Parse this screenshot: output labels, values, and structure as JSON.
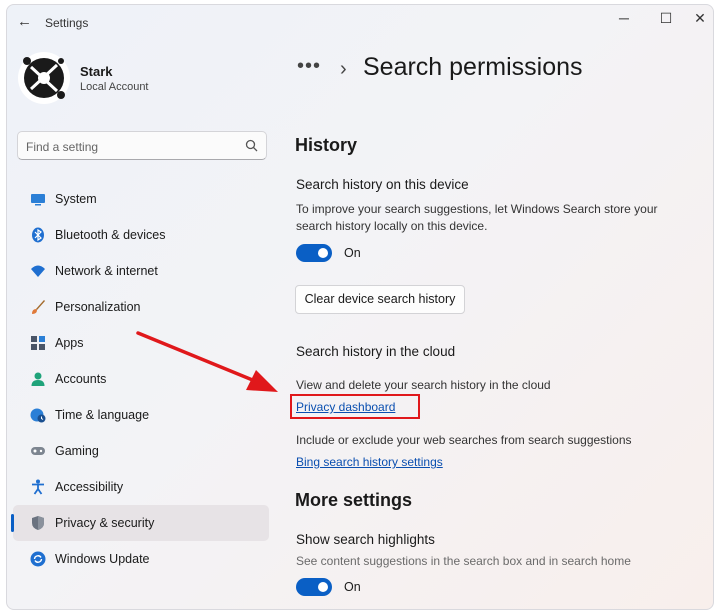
{
  "window": {
    "title": "Settings",
    "back_glyph": "←",
    "minimize_glyph": "─",
    "maximize_glyph": "☐",
    "close_glyph": "✕"
  },
  "user": {
    "name": "Stark",
    "account_type": "Local Account"
  },
  "search": {
    "placeholder": "Find a setting"
  },
  "nav": {
    "items": [
      {
        "label": "System",
        "icon": "system-icon"
      },
      {
        "label": "Bluetooth & devices",
        "icon": "bluetooth-icon"
      },
      {
        "label": "Network & internet",
        "icon": "wifi-icon"
      },
      {
        "label": "Personalization",
        "icon": "brush-icon"
      },
      {
        "label": "Apps",
        "icon": "apps-icon"
      },
      {
        "label": "Accounts",
        "icon": "accounts-icon"
      },
      {
        "label": "Time & language",
        "icon": "globe-clock-icon"
      },
      {
        "label": "Gaming",
        "icon": "gamepad-icon"
      },
      {
        "label": "Accessibility",
        "icon": "accessibility-icon"
      },
      {
        "label": "Privacy & security",
        "icon": "shield-icon",
        "active": true
      },
      {
        "label": "Windows Update",
        "icon": "update-icon"
      }
    ]
  },
  "breadcrumb": {
    "more": "•••",
    "separator": "›",
    "title": "Search permissions"
  },
  "history": {
    "heading": "History",
    "device_title": "Search history on this device",
    "device_desc_line1": "To improve your search suggestions, let Windows Search store your",
    "device_desc_line2": "search history locally on this device.",
    "device_toggle_state": "On",
    "clear_button": "Clear device search history",
    "cloud_title": "Search history in the cloud",
    "cloud_desc": "View and delete your search history in the cloud",
    "privacy_link": "Privacy dashboard",
    "web_desc": "Include or exclude your web searches from search suggestions",
    "bing_link": "Bing search history settings"
  },
  "more_settings": {
    "heading": "More settings",
    "highlights_title": "Show search highlights",
    "highlights_desc": "See content suggestions in the search box and in search home",
    "highlights_toggle_state": "On"
  },
  "colors": {
    "accent": "#0a5fc5",
    "annotation": "#e0181b",
    "link": "#0a4fb0"
  }
}
